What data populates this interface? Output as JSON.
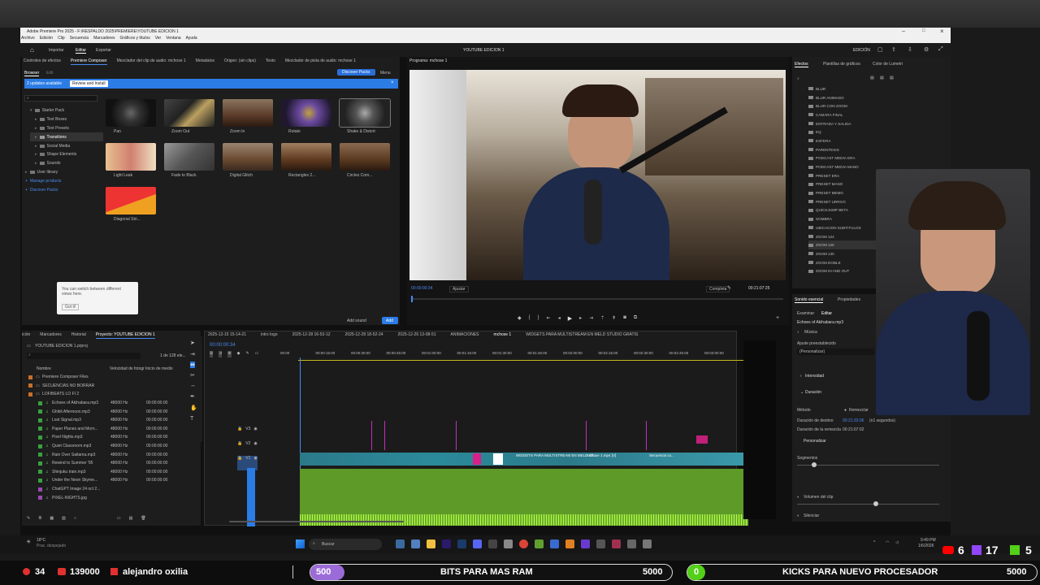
{
  "window": {
    "title": "Adobe Premiere Pro 2025 - F:\\RESPALDO 2025\\PREMIERE\\YOUTUBE EDICION 1",
    "menu": [
      "Archivo",
      "Edición",
      "Clip",
      "Secuencia",
      "Marcadores",
      "Gráficos y títulos",
      "Ver",
      "Ventana",
      "Ayuda"
    ],
    "workspaces": [
      "Importar",
      "Editar",
      "Exportar"
    ],
    "project_name": "YOUTUBE EDICION 1",
    "right_label": "EDICIÓN"
  },
  "source_panel": {
    "tabs": [
      "Controles de efectos",
      "Premiere Composer",
      "Mezclador del clip de audio: mchose 1",
      "Metadatos",
      "Origen: (sin clips)",
      "Texto",
      "Mezclador de pista de audio: mchose 1"
    ],
    "subtabs": [
      "Browser",
      "Edit"
    ],
    "discover_label": "Discover Packs",
    "menu_label": "Menu",
    "update_banner": "2 updates available",
    "review_button": "Review and Install",
    "tree": [
      "Starter Pack",
      "Text Boxes",
      "Text Presets",
      "Transitions",
      "Social Media",
      "Shape Elements",
      "Sounds",
      "User library",
      "Manage products",
      "Discover Packs"
    ],
    "thumbs": [
      "Pan",
      "Zoom Out",
      "Zoom In",
      "Rotate",
      "Shake & Distort",
      "Light Leak",
      "Fade to Black",
      "Digital Glitch",
      "Rectangles 2...",
      "Circles Com...",
      "Diagonal Stri..."
    ],
    "tooltip_text": "You can switch between different views here.",
    "tooltip_button": "Got it!",
    "add_sound_label": "Add sound",
    "add_label": "Add"
  },
  "program": {
    "tab": "Programa: mchose 1",
    "timecode": "00:00:00:34",
    "fit": "Ajustar",
    "quality": "Completa",
    "duration": "00:21:07:25"
  },
  "effects_panel": {
    "tabs": [
      "Efectos",
      "Plantillas de gráficos",
      "Color de Lumetri"
    ],
    "items": [
      "BLUR",
      "BLUR ANIMADO",
      "BLUR CON ZOOM",
      "CAMARA FINAL",
      "ENTRADA Y SALIDA",
      "EQ",
      "ESFERA",
      "PARENTESIS",
      "PODCAST MEDIA ERA",
      "PODCAST MEDIA MANO",
      "PRESET ERA",
      "PRESET MANO",
      "PRESET MEMO",
      "PRESET URRIVC",
      "QUICKJUMP BETA",
      "SOMBRA",
      "UBICACION SUBTITULOS",
      "ZOOM 124",
      "ZOOM 125",
      "ZOOM 130",
      "ZOOM DOBLE",
      "ZOOM IN AND OUT"
    ]
  },
  "essential_sound": {
    "tabs": [
      "Sonido esencial",
      "Propiedades"
    ],
    "subtabs": [
      "Examinar",
      "Editar"
    ],
    "clip_name": "Echoes of Akihabara.mp3",
    "type": "Música",
    "preset_label": "Ajuste preestablecido",
    "preset_value": "(Personalizar)",
    "intensity": "Intensidad",
    "duration": "Duración",
    "method_label": "Método",
    "method_value": "Remezclar",
    "target_label": "Duración de destino",
    "target_value": "00:21:33:06",
    "target_seconds": "(n1 segundos)",
    "remix_label": "Duración de la remezcla",
    "remix_value": "00:21:07:02",
    "customize": "Personalizar",
    "segments": "Segmentos",
    "clip_volume": "Volumen del clip",
    "silence": "Silenciar"
  },
  "project_panel": {
    "tabs": [
      "ición",
      "Marcadores",
      "Historial",
      "Proyecto: YOUTUBE EDICION 1"
    ],
    "file": "YOUTUBE EDICION 1.prproj",
    "count": "1 de 128 ele...",
    "columns": [
      "Nombre",
      "Velocidad de fotogr",
      "Inicio de medio"
    ],
    "rows": [
      {
        "name": "Premiere Composer Files",
        "rate": "",
        "start": ""
      },
      {
        "name": "SECUENCIAS NO BORRAR",
        "rate": "",
        "start": ""
      },
      {
        "name": "LOFIBEATS LO FI 2",
        "rate": "",
        "start": ""
      },
      {
        "name": "Echoes of Akihabara.mp3",
        "rate": "48000 Hz",
        "start": "00:00:00:00"
      },
      {
        "name": "Ghibli Afternoon.mp3",
        "rate": "48000 Hz",
        "start": "00:00:00:00"
      },
      {
        "name": "Lost Signal.mp3",
        "rate": "48000 Hz",
        "start": "00:00:00:00"
      },
      {
        "name": "Paper Planes and Morn...",
        "rate": "48000 Hz",
        "start": "00:00:00:00"
      },
      {
        "name": "Pixel Nights.mp3",
        "rate": "48000 Hz",
        "start": "00:00:00:00"
      },
      {
        "name": "Quiet Classroom.mp3",
        "rate": "48000 Hz",
        "start": "00:00:00:00"
      },
      {
        "name": "Rain Over Saitama.mp3",
        "rate": "48000 Hz",
        "start": "00:00:00:00"
      },
      {
        "name": "Rewind to Summer '95",
        "rate": "48000 Hz",
        "start": "00:00:00:00"
      },
      {
        "name": "Shinjuku train.mp3",
        "rate": "48000 Hz",
        "start": "00:00:00:00"
      },
      {
        "name": "Under the Neon Skyme...",
        "rate": "48000 Hz",
        "start": "00:00:00:00"
      },
      {
        "name": "ChatGPT Image 24 oct 2...",
        "rate": "",
        "start": ""
      },
      {
        "name": "PIXEL-NIGHTS.jpg",
        "rate": "",
        "start": ""
      }
    ]
  },
  "timeline": {
    "tabs": [
      "2025-12-15 15-14-21",
      "intro logo",
      "2025-12-28 16-53-12",
      "2025-12-28 18-52-24",
      "2025-12-26 13-08-51",
      "ANIMACIONES",
      "mchose 1",
      "WIDGETS PARA MULTISTREAM EN MELD STUDIO GRATIS"
    ],
    "timecode": "00:00:00:34",
    "ruler": [
      "00:00",
      "00:00:15:00",
      "00:00:30:00",
      "00:00:45:00",
      "00:01:00:00",
      "00:01:15:00",
      "00:01:30:00",
      "00:01:45:00",
      "00:02:00:00",
      "00:02:15:00",
      "00:02:30:00",
      "00:02:45:00",
      "00:03:00:00"
    ],
    "tracks": [
      "V3",
      "V2",
      "V1"
    ],
    "clip_labels": [
      "WIDGETS PARA MULTISTREAM EN MELD ST...",
      "mchose 1.mp4 [V]",
      "Secuencia co..."
    ]
  },
  "taskbar": {
    "weather_temp": "18°C",
    "weather_desc": "Prac. despejado",
    "search": "Buscar",
    "time": "9:49 PM",
    "date": "1/6/2026"
  },
  "stream_overlay": {
    "stat1": "34",
    "stat2": "139000",
    "user": "alejandro oxilia",
    "bits_current": "500",
    "bits_label": "BITS PARA MAS RAM",
    "bits_goal": "5000",
    "kicks_current": "0",
    "kicks_label": "KICKS PARA NUEVO PROCESADOR",
    "kicks_goal": "5000",
    "youtube_count": "6",
    "twitch_count": "17",
    "kick_count": "5"
  },
  "colors": {
    "accent_blue": "#2c7ce5",
    "audio_green": "#5e9a28",
    "video_teal": "#2b8a9a",
    "bits_purple": "#9b6bd8",
    "kicks_green": "#53d018"
  }
}
